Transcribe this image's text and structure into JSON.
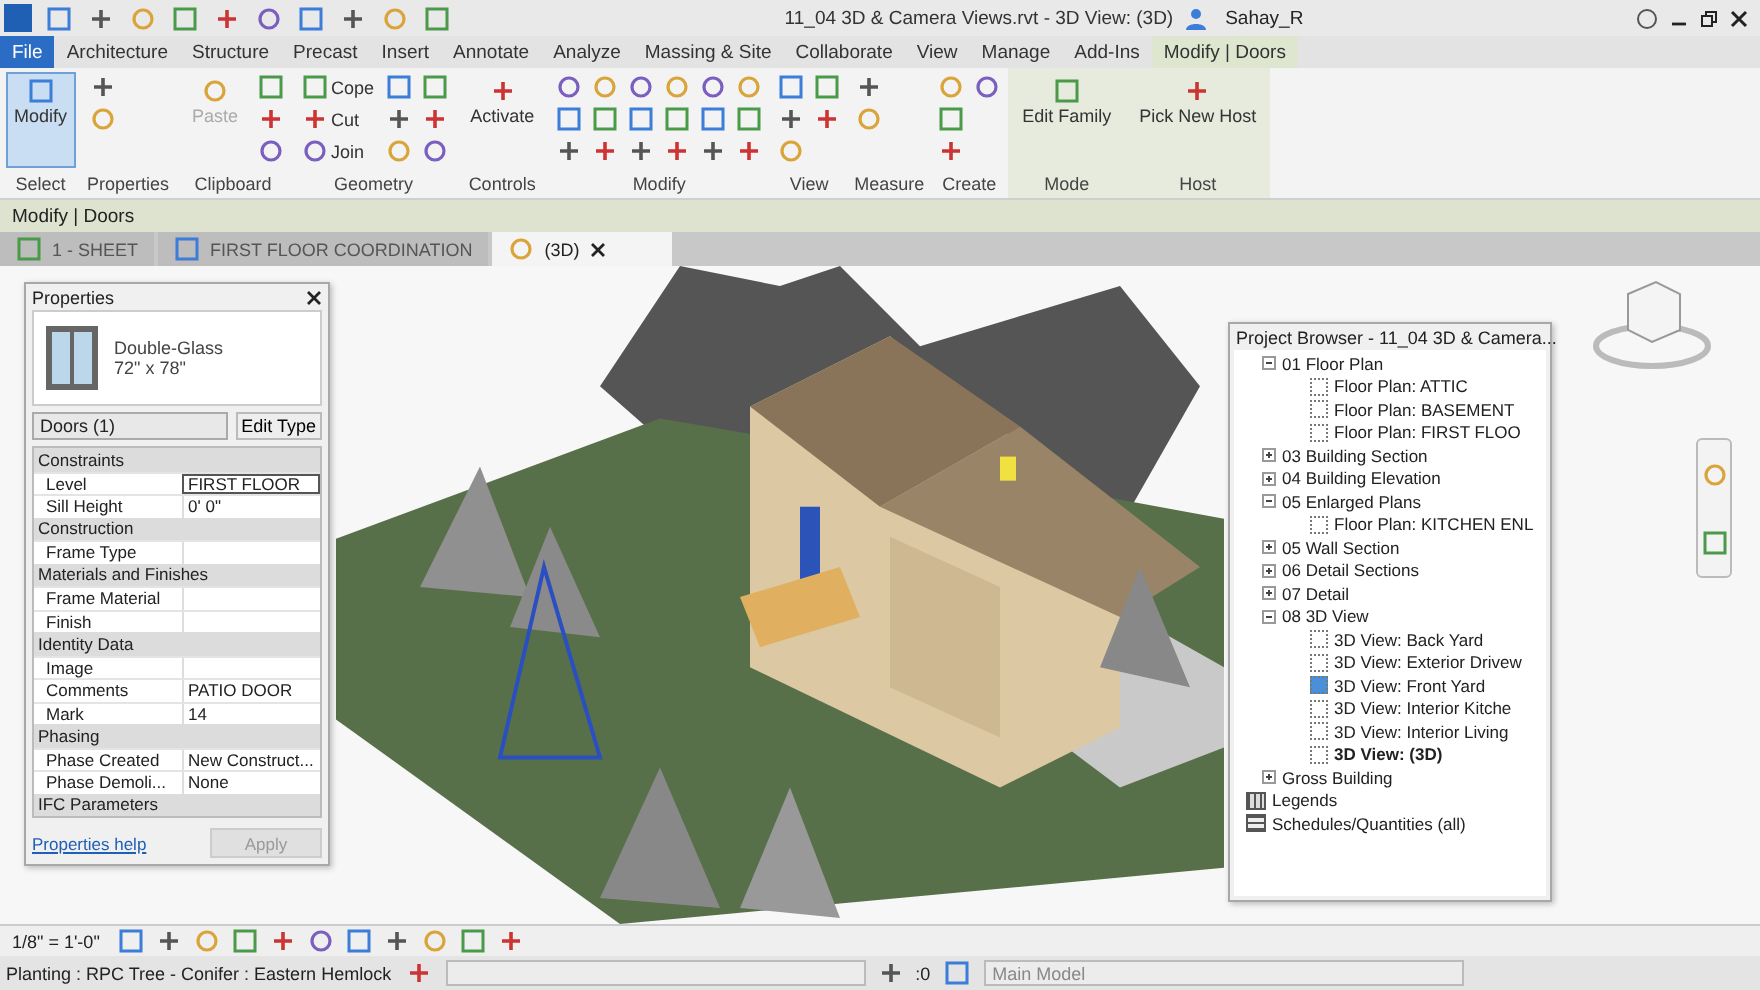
{
  "title_bar": {
    "title": "11_04 3D & Camera Views.rvt - 3D View: (3D)",
    "user": "Sahay_R"
  },
  "ribbon_tabs": [
    {
      "label": "File",
      "kind": "file",
      "selected": false
    },
    {
      "label": "Architecture",
      "kind": "tab",
      "selected": false
    },
    {
      "label": "Structure",
      "kind": "tab",
      "selected": false
    },
    {
      "label": "Precast",
      "kind": "tab",
      "selected": false
    },
    {
      "label": "Insert",
      "kind": "tab",
      "selected": false
    },
    {
      "label": "Annotate",
      "kind": "tab",
      "selected": false
    },
    {
      "label": "Analyze",
      "kind": "tab",
      "selected": false
    },
    {
      "label": "Massing & Site",
      "kind": "tab",
      "selected": false
    },
    {
      "label": "Collaborate",
      "kind": "tab",
      "selected": false
    },
    {
      "label": "View",
      "kind": "tab",
      "selected": false
    },
    {
      "label": "Manage",
      "kind": "tab",
      "selected": false
    },
    {
      "label": "Add-Ins",
      "kind": "tab",
      "selected": false
    },
    {
      "label": "Modify | Doors",
      "kind": "tab",
      "selected": true
    }
  ],
  "ribbon_panels": [
    {
      "title": "Select",
      "context": false,
      "items": [
        {
          "kind": "large",
          "label": "Modify",
          "selected": true,
          "disabled": false
        }
      ]
    },
    {
      "title": "Properties",
      "context": false,
      "items": [
        {
          "kind": "icon"
        },
        {
          "kind": "icon"
        }
      ]
    },
    {
      "title": "Clipboard",
      "context": false,
      "items": [
        {
          "kind": "large",
          "label": "Paste",
          "selected": false,
          "disabled": true
        },
        {
          "kind": "icon"
        },
        {
          "kind": "icon"
        },
        {
          "kind": "icon"
        }
      ]
    },
    {
      "title": "Geometry",
      "context": false,
      "items": [
        {
          "kind": "small",
          "label": "Cope"
        },
        {
          "kind": "small",
          "label": "Cut"
        },
        {
          "kind": "small",
          "label": "Join"
        },
        {
          "kind": "icon"
        },
        {
          "kind": "icon"
        },
        {
          "kind": "icon"
        },
        {
          "kind": "icon"
        },
        {
          "kind": "icon"
        },
        {
          "kind": "icon"
        }
      ]
    },
    {
      "title": "Controls",
      "context": false,
      "items": [
        {
          "kind": "large",
          "label": "Activate",
          "selected": false,
          "disabled": false
        }
      ]
    },
    {
      "title": "Modify",
      "context": false,
      "items": [
        {
          "kind": "icon"
        },
        {
          "kind": "icon"
        },
        {
          "kind": "icon"
        },
        {
          "kind": "icon"
        },
        {
          "kind": "icon"
        },
        {
          "kind": "icon"
        },
        {
          "kind": "icon"
        },
        {
          "kind": "icon"
        },
        {
          "kind": "icon"
        },
        {
          "kind": "icon"
        },
        {
          "kind": "icon"
        },
        {
          "kind": "icon"
        },
        {
          "kind": "icon"
        },
        {
          "kind": "icon"
        },
        {
          "kind": "icon"
        },
        {
          "kind": "icon"
        },
        {
          "kind": "icon"
        },
        {
          "kind": "icon"
        }
      ]
    },
    {
      "title": "View",
      "context": false,
      "items": [
        {
          "kind": "icon"
        },
        {
          "kind": "icon"
        },
        {
          "kind": "icon"
        },
        {
          "kind": "icon"
        },
        {
          "kind": "icon"
        }
      ]
    },
    {
      "title": "Measure",
      "context": false,
      "items": [
        {
          "kind": "icon"
        },
        {
          "kind": "icon"
        }
      ]
    },
    {
      "title": "Create",
      "context": false,
      "items": [
        {
          "kind": "icon"
        },
        {
          "kind": "icon"
        },
        {
          "kind": "icon"
        },
        {
          "kind": "icon"
        }
      ]
    },
    {
      "title": "Mode",
      "context": true,
      "items": [
        {
          "kind": "large",
          "label": "Edit Family",
          "selected": false,
          "disabled": false
        }
      ]
    },
    {
      "title": "Host",
      "context": true,
      "items": [
        {
          "kind": "large",
          "label": "Pick New Host",
          "selected": false,
          "disabled": false
        }
      ]
    }
  ],
  "options_bar": {
    "label": "Modify | Doors"
  },
  "view_tabs": [
    {
      "label": "1 - SHEET",
      "kind": "sheet",
      "selected": false
    },
    {
      "label": "FIRST FLOOR COORDINATION",
      "kind": "plan",
      "selected": false
    },
    {
      "label": "(3D)",
      "kind": "model",
      "selected": true
    }
  ],
  "properties": {
    "title": "Properties",
    "type_name": "Double-Glass",
    "type_size": "72\" x 78\"",
    "selector": "Doors (1)",
    "edit_type": "Edit Type",
    "groups": [
      {
        "name": "Constraints",
        "rows": [
          {
            "label": "Level",
            "value": "FIRST FLOOR",
            "editing": true
          },
          {
            "label": "Sill Height",
            "value": "0' 0\"",
            "editing": false
          }
        ]
      },
      {
        "name": "Construction",
        "rows": [
          {
            "label": "Frame Type",
            "editing": false
          }
        ]
      },
      {
        "name": "Materials and Finishes",
        "rows": [
          {
            "label": "Frame Material",
            "editing": false
          },
          {
            "label": "Finish",
            "editing": false
          }
        ]
      },
      {
        "name": "Identity Data",
        "rows": [
          {
            "label": "Image",
            "editing": false
          },
          {
            "label": "Comments",
            "value": "PATIO DOOR",
            "editing": false
          },
          {
            "label": "Mark",
            "value": "14",
            "editing": false
          }
        ]
      },
      {
        "name": "Phasing",
        "rows": [
          {
            "label": "Phase Created",
            "value": "New Construct...",
            "editing": false
          },
          {
            "label": "Phase Demoli...",
            "value": "None",
            "editing": false
          }
        ]
      },
      {
        "name": "IFC Parameters"
      }
    ],
    "help_link": "Properties help",
    "apply_button": {
      "label": "Apply",
      "disabled": true
    }
  },
  "project_browser": {
    "title": "Project Browser - 11_04 3D & Camera...",
    "view_groups": [
      {
        "label": "01 Floor Plan",
        "expanded": true,
        "children": [
          {
            "label": "Floor Plan: ATTIC",
            "current": false,
            "highlighted": false
          },
          {
            "label": "Floor Plan: BASEMENT",
            "current": false,
            "highlighted": false
          },
          {
            "label": "Floor Plan: FIRST FLOO",
            "current": false,
            "highlighted": false
          }
        ]
      },
      {
        "label": "03 Building Section",
        "expanded": false
      },
      {
        "label": "04 Building Elevation",
        "expanded": false
      },
      {
        "label": "05 Enlarged Plans",
        "expanded": true,
        "children": [
          {
            "label": "Floor Plan: KITCHEN ENL",
            "current": false,
            "highlighted": false
          }
        ]
      },
      {
        "label": "05 Wall Section",
        "expanded": false
      },
      {
        "label": "06 Detail Sections",
        "expanded": false
      },
      {
        "label": "07 Detail",
        "expanded": false
      },
      {
        "label": "08 3D View",
        "expanded": true,
        "children": [
          {
            "label": "3D View: Back Yard",
            "current": false,
            "highlighted": false
          },
          {
            "label": "3D View: Exterior Drivew",
            "current": false,
            "highlighted": false
          },
          {
            "label": "3D View: Front Yard",
            "current": false,
            "highlighted": true
          },
          {
            "label": "3D View: Interior Kitche",
            "current": false,
            "highlighted": false
          },
          {
            "label": "3D View: Interior Living",
            "current": false,
            "highlighted": false
          },
          {
            "label": "3D View: (3D)",
            "current": true,
            "highlighted": false
          }
        ]
      },
      {
        "label": "Gross Building",
        "expanded": false
      }
    ],
    "other_nodes": [
      {
        "label": "Legends",
        "kind": "legends"
      },
      {
        "label": "Schedules/Quantities (all)",
        "kind": "schedules"
      }
    ]
  },
  "view_control_bar": {
    "scale": "1/8\" = 1'-0\""
  },
  "status_bar": {
    "message": "Planting : RPC Tree - Conifer : Eastern Hemlock",
    "count": ":0",
    "model": "Main Model"
  }
}
